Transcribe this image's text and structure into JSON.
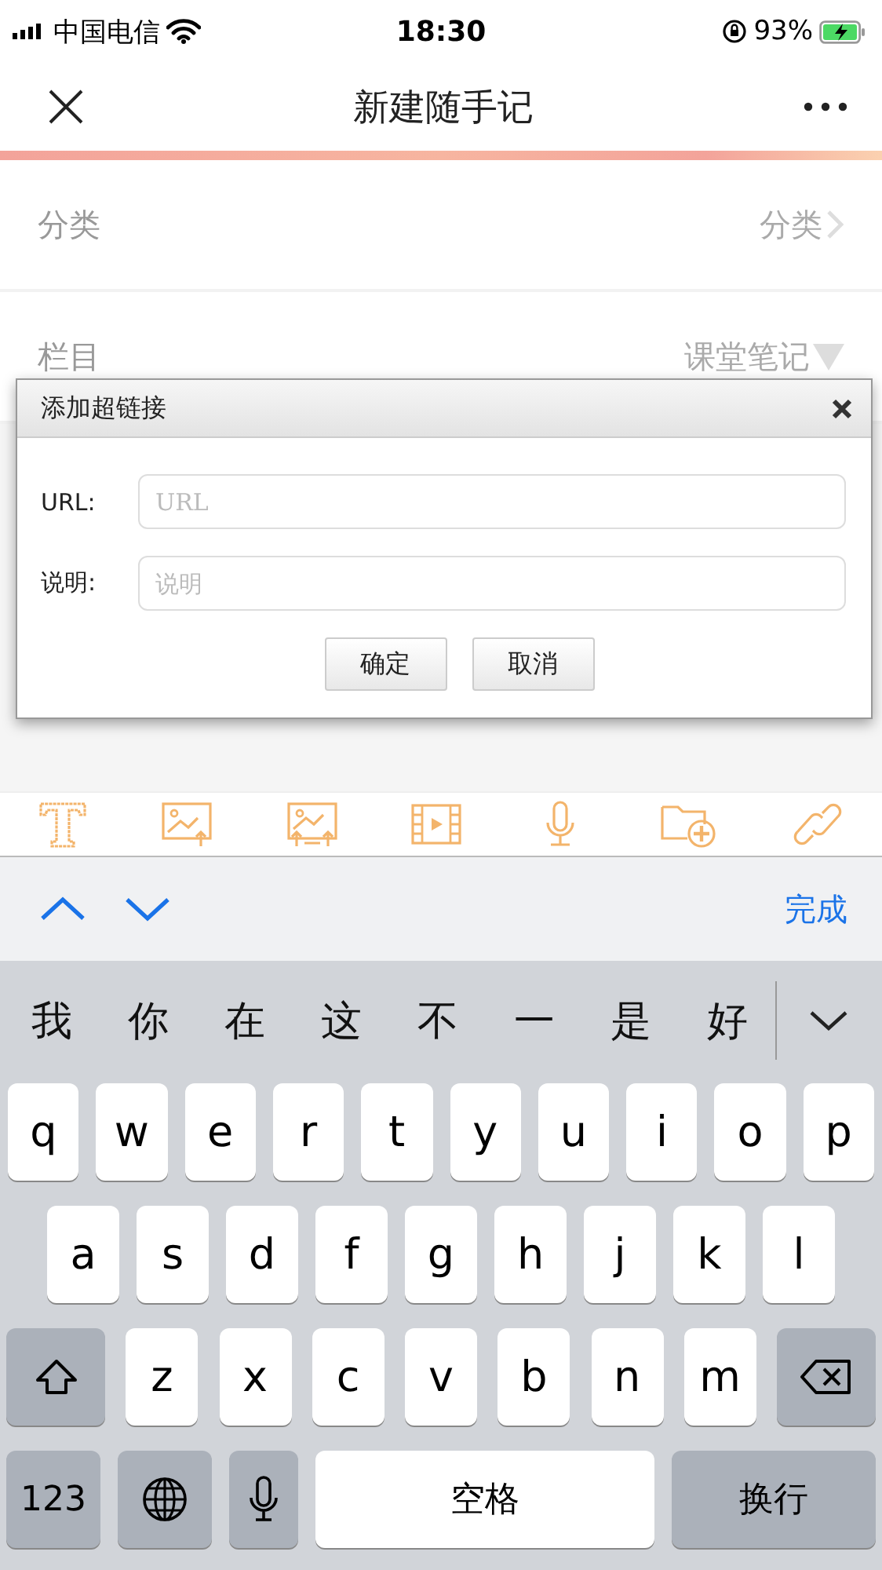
{
  "status_bar": {
    "carrier": "中国电信",
    "time": "18:30",
    "battery": "93%"
  },
  "nav": {
    "title": "新建随手记"
  },
  "form": [
    {
      "kind": "link",
      "label": "分类",
      "value": "分类"
    },
    {
      "kind": "dropdown",
      "label": "栏目",
      "value": "课堂笔记"
    }
  ],
  "dialog": {
    "title": "添加超链接",
    "fields": [
      {
        "label": "URL:",
        "placeholder": "URL"
      },
      {
        "label": "说明:",
        "placeholder": "说明"
      }
    ],
    "buttons": [
      "确定",
      "取消"
    ]
  },
  "accessory": {
    "done": "完成"
  },
  "candidates": [
    "我",
    "你",
    "在",
    "这",
    "不",
    "一",
    "是",
    "好"
  ],
  "keyboard": [
    [
      {
        "kind": "char",
        "label": "q"
      },
      {
        "kind": "char",
        "label": "w"
      },
      {
        "kind": "char",
        "label": "e"
      },
      {
        "kind": "char",
        "label": "r"
      },
      {
        "kind": "char",
        "label": "t"
      },
      {
        "kind": "char",
        "label": "y"
      },
      {
        "kind": "char",
        "label": "u"
      },
      {
        "kind": "char",
        "label": "i"
      },
      {
        "kind": "char",
        "label": "o"
      },
      {
        "kind": "char",
        "label": "p"
      }
    ],
    [
      {
        "kind": "char",
        "label": "a"
      },
      {
        "kind": "char",
        "label": "s"
      },
      {
        "kind": "char",
        "label": "d"
      },
      {
        "kind": "char",
        "label": "f"
      },
      {
        "kind": "char",
        "label": "g"
      },
      {
        "kind": "char",
        "label": "h"
      },
      {
        "kind": "char",
        "label": "j"
      },
      {
        "kind": "char",
        "label": "k"
      },
      {
        "kind": "char",
        "label": "l"
      }
    ],
    [
      {
        "kind": "shift"
      },
      {
        "kind": "char",
        "label": "z"
      },
      {
        "kind": "char",
        "label": "x"
      },
      {
        "kind": "char",
        "label": "c"
      },
      {
        "kind": "char",
        "label": "v"
      },
      {
        "kind": "char",
        "label": "b"
      },
      {
        "kind": "char",
        "label": "n"
      },
      {
        "kind": "char",
        "label": "m"
      },
      {
        "kind": "delete"
      }
    ],
    [
      {
        "kind": "func",
        "label": "123"
      },
      {
        "kind": "globe"
      },
      {
        "kind": "mic"
      },
      {
        "kind": "space",
        "label": "空格"
      },
      {
        "kind": "func",
        "label": "换行"
      }
    ]
  ]
}
